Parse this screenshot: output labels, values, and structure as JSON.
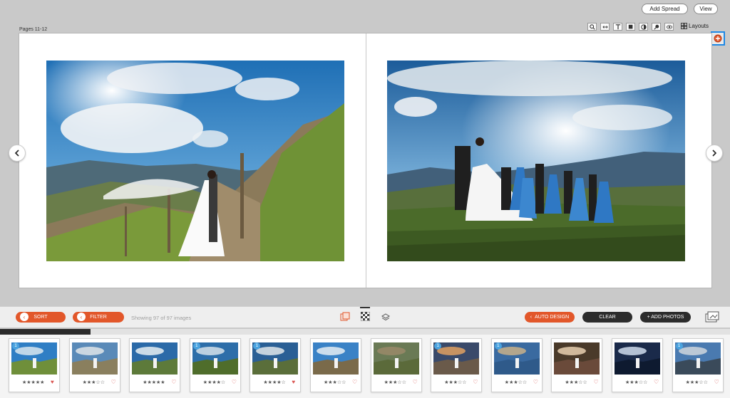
{
  "toolbar": {
    "add_spread": "Add Spread",
    "view": "View",
    "layouts": "Layouts",
    "pages_label": "Pages 11-12"
  },
  "bottom": {
    "sort": "SORT",
    "filter": "FILTER",
    "showing": "Showing 97 of 97 images",
    "auto_design": "AUTO DESIGN",
    "clear": "CLEAR",
    "add_photos": "+ ADD PHOTOS"
  },
  "thumbnails": [
    {
      "stars": "★★★★★",
      "heart": "♥",
      "badge": "1"
    },
    {
      "stars": "★★★☆☆",
      "heart": "♡",
      "badge": ""
    },
    {
      "stars": "★★★★★",
      "heart": "♡",
      "badge": ""
    },
    {
      "stars": "★★★★☆",
      "heart": "♡",
      "badge": "1"
    },
    {
      "stars": "★★★★☆",
      "heart": "♥",
      "badge": "1"
    },
    {
      "stars": "★★★☆☆",
      "heart": "♡",
      "badge": ""
    },
    {
      "stars": "★★★☆☆",
      "heart": "♡",
      "badge": ""
    },
    {
      "stars": "★★★☆☆",
      "heart": "♡",
      "badge": "1"
    },
    {
      "stars": "★★★☆☆",
      "heart": "♡",
      "badge": "1"
    },
    {
      "stars": "★★★☆☆",
      "heart": "♡",
      "badge": ""
    },
    {
      "stars": "★★★☆☆",
      "heart": "♡",
      "badge": ""
    },
    {
      "stars": "★★★☆☆",
      "heart": "♡",
      "badge": "1"
    }
  ],
  "colors": {
    "accent": "#e2572a",
    "highlight": "#1e88e5"
  }
}
